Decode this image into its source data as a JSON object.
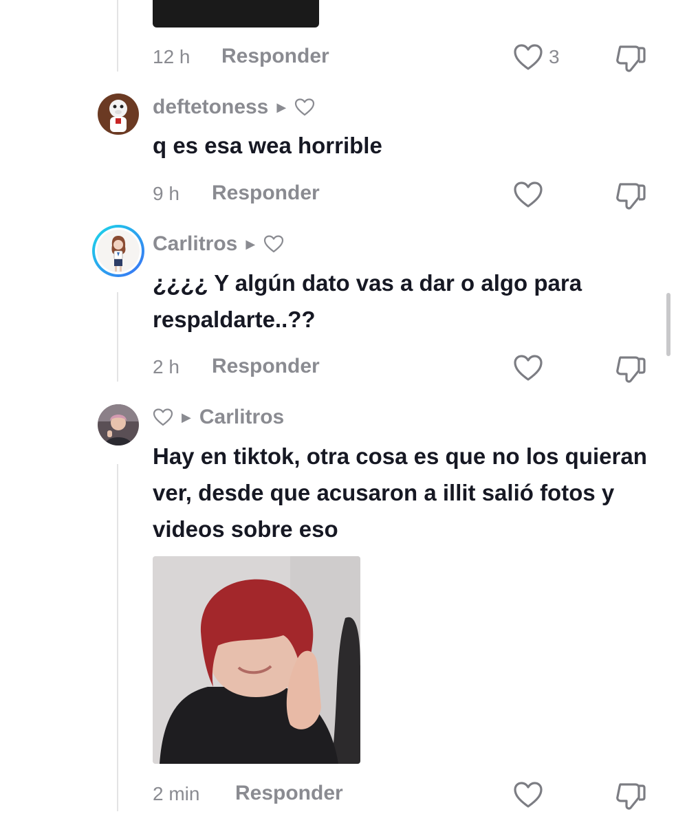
{
  "comments": [
    {
      "time": "12 h",
      "reply_label": "Responder",
      "likes": "3"
    },
    {
      "username": "deftetoness",
      "text": "q es esa wea horrible",
      "time": "9 h",
      "reply_label": "Responder"
    },
    {
      "username": "Carlitros",
      "text": "¿¿¿¿ Y algún dato vas a dar o algo para respaldarte..??",
      "time": "2 h",
      "reply_label": "Responder"
    },
    {
      "reply_to": "Carlitros",
      "text": "Hay en tiktok, otra cosa es que no los quieran ver, desde que acusaron a illit salió fotos y videos sobre eso",
      "time": "2 min",
      "reply_label": "Responder"
    }
  ],
  "colors": {
    "text_primary": "#161823",
    "text_secondary": "#8a8b91",
    "story_ring_start": "#1bd9e8",
    "story_ring_end": "#3b6ff5"
  },
  "icons": [
    "heart-outline-icon",
    "thumbs-down-icon",
    "play-triangle-icon"
  ]
}
